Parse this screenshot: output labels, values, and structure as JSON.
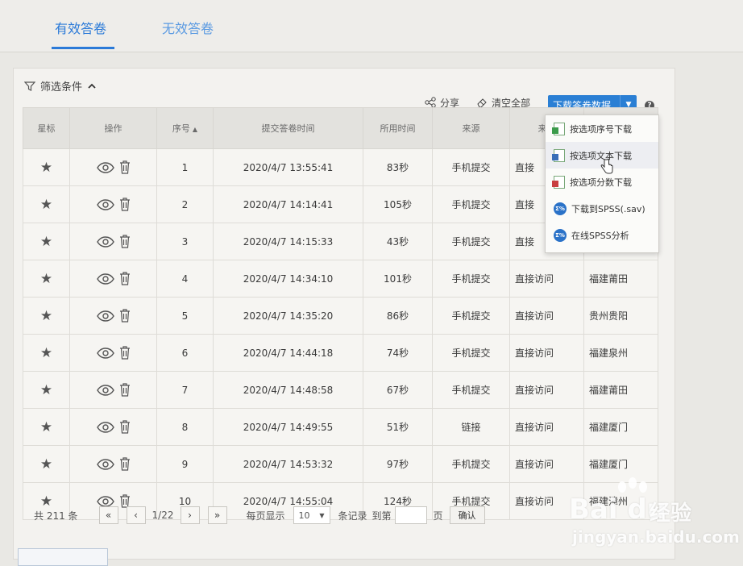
{
  "tabs": [
    {
      "label": "有效答卷",
      "active": true
    },
    {
      "label": "无效答卷",
      "active": false
    }
  ],
  "filter": {
    "label": "筛选条件"
  },
  "toolbar": {
    "share_label": "分享",
    "clear_label": "清空全部",
    "download_label": "下载答卷数据",
    "help_icon": "question-icon"
  },
  "columns": [
    "星标",
    "操作",
    "序号",
    "提交答卷时间",
    "所用时间",
    "来源",
    "来源"
  ],
  "rows": [
    {
      "index": "1",
      "time": "2020/4/7 13:55:41",
      "duration": "83秒",
      "source": "手机提交",
      "channel": "直接",
      "region": ""
    },
    {
      "index": "2",
      "time": "2020/4/7 14:14:41",
      "duration": "105秒",
      "source": "手机提交",
      "channel": "直接",
      "region": ""
    },
    {
      "index": "3",
      "time": "2020/4/7 14:15:33",
      "duration": "43秒",
      "source": "手机提交",
      "channel": "直接",
      "region": ""
    },
    {
      "index": "4",
      "time": "2020/4/7 14:34:10",
      "duration": "101秒",
      "source": "手机提交",
      "channel": "直接访问",
      "region": "福建莆田"
    },
    {
      "index": "5",
      "time": "2020/4/7 14:35:20",
      "duration": "86秒",
      "source": "手机提交",
      "channel": "直接访问",
      "region": "贵州贵阳"
    },
    {
      "index": "6",
      "time": "2020/4/7 14:44:18",
      "duration": "74秒",
      "source": "手机提交",
      "channel": "直接访问",
      "region": "福建泉州"
    },
    {
      "index": "7",
      "time": "2020/4/7 14:48:58",
      "duration": "67秒",
      "source": "手机提交",
      "channel": "直接访问",
      "region": "福建莆田"
    },
    {
      "index": "8",
      "time": "2020/4/7 14:49:55",
      "duration": "51秒",
      "source": "链接",
      "channel": "直接访问",
      "region": "福建厦门"
    },
    {
      "index": "9",
      "time": "2020/4/7 14:53:32",
      "duration": "97秒",
      "source": "手机提交",
      "channel": "直接访问",
      "region": "福建厦门"
    },
    {
      "index": "10",
      "time": "2020/4/7 14:55:04",
      "duration": "124秒",
      "source": "手机提交",
      "channel": "直接访问",
      "region": "福建漳州"
    }
  ],
  "dropdown": [
    {
      "label": "按选项序号下载",
      "icon": "xls-green"
    },
    {
      "label": "按选项文本下载",
      "icon": "xls-blue"
    },
    {
      "label": "按选项分数下载",
      "icon": "xls-red"
    },
    {
      "label": "下载到SPSS(.sav)",
      "icon": "spss"
    },
    {
      "label": "在线SPSS分析",
      "icon": "spss"
    }
  ],
  "pager": {
    "total": "共 211 条",
    "page_info": "1/22",
    "per_page_label": "每页显示",
    "per_page_value": "10",
    "records_label": "条记录",
    "goto_label": "到第",
    "page_unit": "页",
    "confirm_label": "确认"
  },
  "watermark": {
    "brand": "Bai du",
    "cn": "经验",
    "url": "jingyan.baidu.com"
  },
  "colors": {
    "accent": "#2a7fd4",
    "tab_active": "#2b7ad8"
  }
}
